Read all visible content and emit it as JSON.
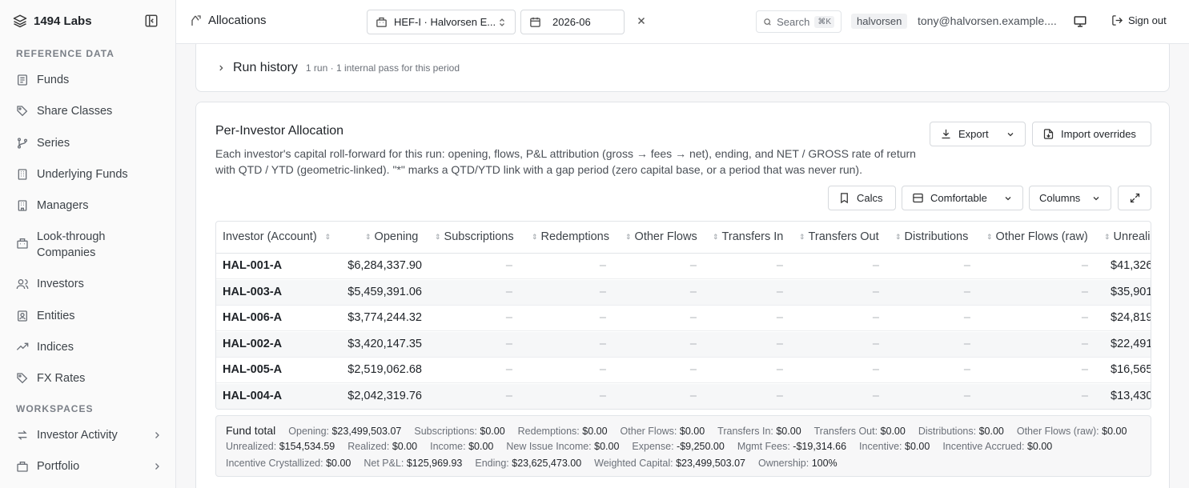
{
  "app": {
    "brand": "1494 Labs"
  },
  "sidebar": {
    "reference_label": "REFERENCE DATA",
    "reference_items": [
      {
        "label": "Funds",
        "icon": "layers-icon"
      },
      {
        "label": "Share Classes",
        "icon": "tag-icon"
      },
      {
        "label": "Series",
        "icon": "branch-icon"
      },
      {
        "label": "Underlying Funds",
        "icon": "building-icon"
      },
      {
        "label": "Managers",
        "icon": "building-icon"
      },
      {
        "label": "Look-through",
        "label2": "Companies",
        "icon": "building-icon"
      },
      {
        "label": "Investors",
        "icon": "user-icon"
      },
      {
        "label": "Entities",
        "icon": "badge-icon"
      },
      {
        "label": "Indices",
        "icon": "trend-icon"
      },
      {
        "label": "FX Rates",
        "icon": "tag-icon"
      }
    ],
    "workspaces_label": "WORKSPACES",
    "workspace_items": [
      {
        "label": "Investor Activity",
        "icon": "swap-icon"
      },
      {
        "label": "Portfolio",
        "icon": "building-icon"
      }
    ]
  },
  "topbar": {
    "page_title": "Allocations",
    "fund_select": "HEF-I · Halvorsen E...",
    "period": "2026-06",
    "search_placeholder": "Search",
    "search_kbd": "⌘K",
    "user_tag": "halvorsen",
    "user_email": "tony@halvorsen.example....",
    "signout": "Sign out"
  },
  "run_history": {
    "title": "Run history",
    "subtitle": "1 run · 1 internal pass for this period"
  },
  "allocation": {
    "title": "Per-Investor Allocation",
    "description": "Each investor's capital roll-forward for this run: opening, flows, P&L attribution (gross → fees → net), ending, and NET / GROSS rate of return with QTD / YTD (geometric-linked). \"*\" marks a QTD/YTD link with a gap period (zero capital base, or a period that was never run).",
    "export_label": "Export",
    "import_label": "Import overrides",
    "calcs_label": "Calcs",
    "density_label": "Comfortable",
    "columns_label": "Columns"
  },
  "table": {
    "columns": [
      "Investor (Account)",
      "Opening",
      "Subscriptions",
      "Redemptions",
      "Other Flows",
      "Transfers In",
      "Transfers Out",
      "Distributions",
      "Other Flows (raw)",
      "Unreali"
    ],
    "dash": "–",
    "rows": [
      {
        "account": "HAL-001-A",
        "opening": "$6,284,337.90",
        "unreal": "$41,326"
      },
      {
        "account": "HAL-003-A",
        "opening": "$5,459,391.06",
        "unreal": "$35,901"
      },
      {
        "account": "HAL-006-A",
        "opening": "$3,774,244.32",
        "unreal": "$24,819"
      },
      {
        "account": "HAL-002-A",
        "opening": "$3,420,147.35",
        "unreal": "$22,491"
      },
      {
        "account": "HAL-005-A",
        "opening": "$2,519,062.68",
        "unreal": "$16,565"
      },
      {
        "account": "HAL-004-A",
        "opening": "$2,042,319.76",
        "unreal": "$13,430"
      }
    ]
  },
  "fund_total": {
    "title": "Fund total",
    "line1": [
      {
        "k": "Opening:",
        "v": "$23,499,503.07"
      },
      {
        "k": "Subscriptions:",
        "v": "$0.00"
      },
      {
        "k": "Redemptions:",
        "v": "$0.00"
      },
      {
        "k": "Other Flows:",
        "v": "$0.00"
      },
      {
        "k": "Transfers In:",
        "v": "$0.00"
      },
      {
        "k": "Transfers Out:",
        "v": "$0.00"
      },
      {
        "k": "Distributions:",
        "v": "$0.00"
      },
      {
        "k": "Other Flows (raw):",
        "v": "$0.00"
      }
    ],
    "line2": [
      {
        "k": "Unrealized:",
        "v": "$154,534.59"
      },
      {
        "k": "Realized:",
        "v": "$0.00"
      },
      {
        "k": "Income:",
        "v": "$0.00"
      },
      {
        "k": "New Issue Income:",
        "v": "$0.00"
      },
      {
        "k": "Expense:",
        "v": "-$9,250.00"
      },
      {
        "k": "Mgmt Fees:",
        "v": "-$19,314.66"
      },
      {
        "k": "Incentive:",
        "v": "$0.00"
      },
      {
        "k": "Incentive Accrued:",
        "v": "$0.00"
      }
    ],
    "line3": [
      {
        "k": "Incentive Crystallized:",
        "v": "$0.00"
      },
      {
        "k": "Net P&L:",
        "v": "$125,969.93"
      },
      {
        "k": "Ending:",
        "v": "$23,625,473.00"
      },
      {
        "k": "Weighted Capital:",
        "v": "$23,499,503.07"
      },
      {
        "k": "Ownership:",
        "v": "100%"
      }
    ]
  }
}
